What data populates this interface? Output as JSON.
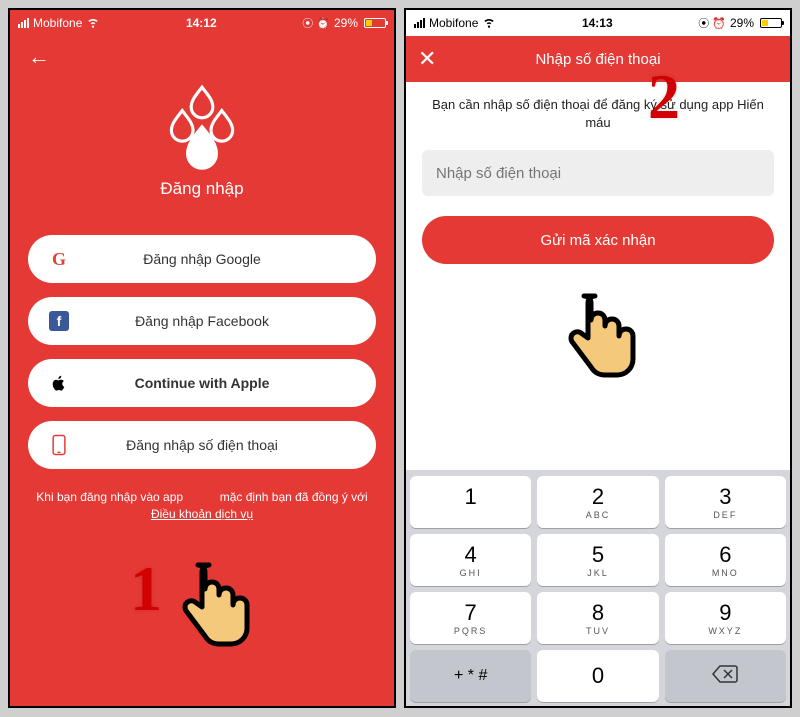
{
  "statusbar": {
    "carrier": "Mobifone",
    "time_left": "14:12",
    "time_right": "14:13",
    "battery": "29%",
    "alarm": "⦿ ⏰"
  },
  "left": {
    "title": "Đăng nhập",
    "google": "Đăng nhập Google",
    "facebook": "Đăng nhập Facebook",
    "apple": "Continue with Apple",
    "phone": "Đăng nhập số điện thoại",
    "terms_1": "Khi bạn đăng nhập vào app",
    "terms_2": "mặc định bạn đã đồng ý với",
    "terms_link": "Điều khoản dịch vụ"
  },
  "right": {
    "header": "Nhập số điện thoại",
    "instruction": "Bạn cần nhập số điện thoại để đăng ký sử dụng app Hiến máu",
    "placeholder": "Nhập số điện thoại",
    "send": "Gửi mã xác nhận"
  },
  "keypad": {
    "k1": "1",
    "k2": "2",
    "k3": "3",
    "k4": "4",
    "k5": "5",
    "k6": "6",
    "k7": "7",
    "k8": "8",
    "k9": "9",
    "k0": "0",
    "sub2": "ABC",
    "sub3": "DEF",
    "sub4": "GHI",
    "sub5": "JKL",
    "sub6": "MNO",
    "sub7": "PQRS",
    "sub8": "TUV",
    "sub9": "WXYZ",
    "sym": "+ * #"
  },
  "steps": {
    "one": "1",
    "two": "2"
  }
}
